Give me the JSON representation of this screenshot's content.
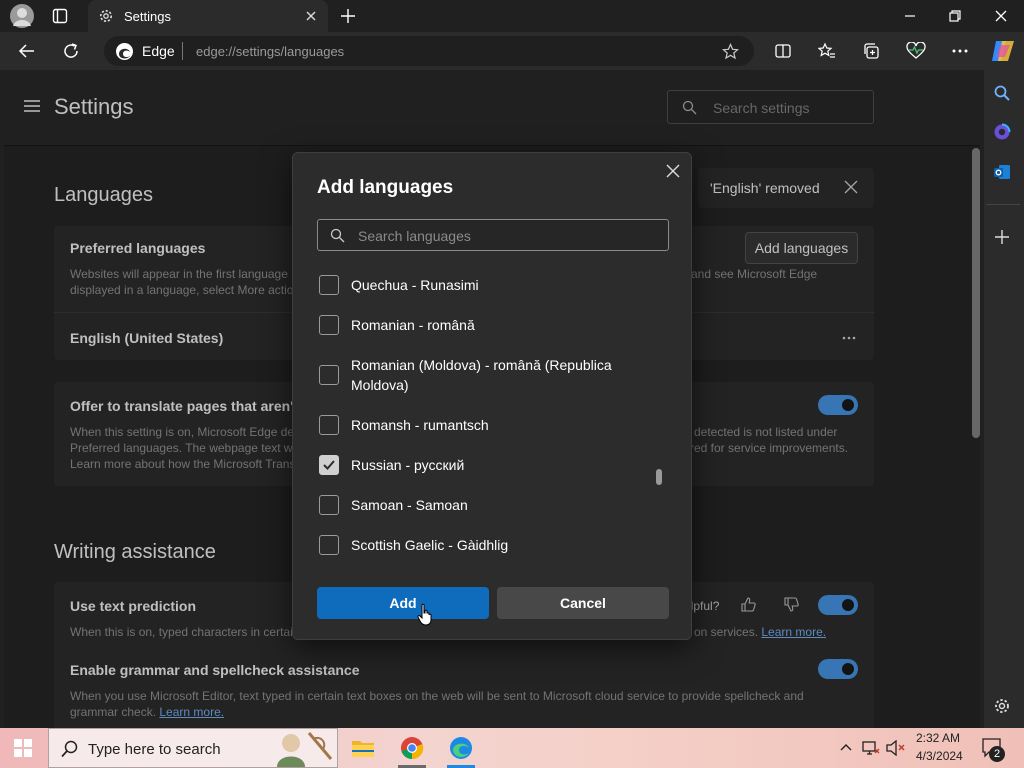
{
  "browser": {
    "tab_title": "Settings",
    "address_brand": "Edge",
    "url_prefix": "edge://settings/",
    "url_path": "languages"
  },
  "settings": {
    "title": "Settings",
    "search_placeholder": "Search settings"
  },
  "notification": {
    "text": "'English' removed"
  },
  "languages_section": {
    "title": "Languages",
    "preferred": {
      "title": "Preferred languages",
      "desc_line1_left": "Websites will appear in the first language",
      "desc_line1_right": "and see Microsoft Edge",
      "desc_line2_left": "displayed in a language, select More actio",
      "add_button": "Add languages"
    },
    "current_language": "English (United States)",
    "translate": {
      "title_left": "Offer to translate pages that aren't",
      "desc_line1_left": "When this setting is on, Microsoft Edge de",
      "desc_line1_right": "detected is not listed under",
      "desc_line2_left": "Preferred languages. The webpage text wi",
      "desc_line2_right": "red for service improvements.",
      "desc_line3_left": "Learn more about how the Microsoft Trans"
    }
  },
  "writing_section": {
    "title": "Writing assistance",
    "prediction": {
      "title": "Use text prediction",
      "helpful": "elpful?",
      "desc_left": "When this is on, typed characters in certai",
      "desc_right": "on services.",
      "learn_more": "Learn more."
    },
    "grammar": {
      "title": "Enable grammar and spellcheck assistance",
      "desc_line1": "When you use Microsoft Editor, text typed in certain text boxes on the web will be sent to Microsoft cloud service to provide spellcheck and",
      "desc_line2_prefix": "grammar check.",
      "learn_more": "Learn more."
    }
  },
  "dialog": {
    "title": "Add languages",
    "search_placeholder": "Search languages",
    "languages": [
      {
        "label": "Quechua - Runasimi",
        "checked": false
      },
      {
        "label": "Romanian - română",
        "checked": false
      },
      {
        "label": "Romanian (Moldova) - română (Republica Moldova)",
        "checked": false
      },
      {
        "label": "Romansh - rumantsch",
        "checked": false
      },
      {
        "label": "Russian - русский",
        "checked": true
      },
      {
        "label": "Samoan - Samoan",
        "checked": false
      },
      {
        "label": "Scottish Gaelic - Gàidhlig",
        "checked": false
      }
    ],
    "add_button": "Add",
    "cancel_button": "Cancel"
  },
  "taskbar": {
    "search_placeholder": "Type here to search",
    "time": "2:32 AM",
    "date": "4/3/2024",
    "notification_count": "2"
  },
  "colors": {
    "accent": "#0f6cbd",
    "toggle_on": "#4a9cf0",
    "link": "#7cb8ff"
  }
}
